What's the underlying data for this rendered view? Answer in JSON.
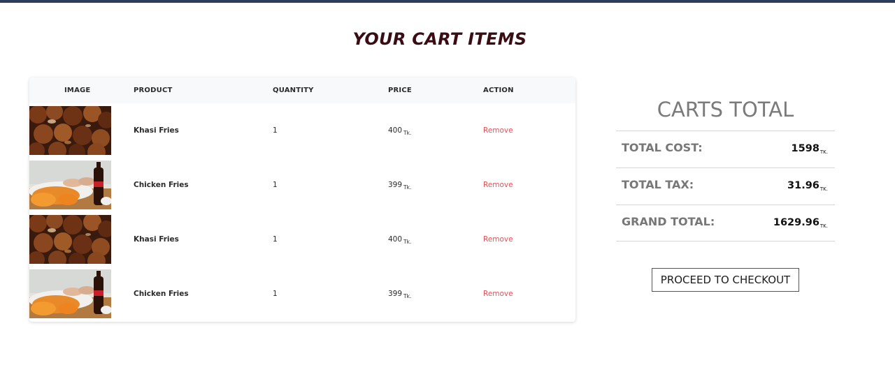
{
  "page": {
    "title": "YOUR CART ITEMS",
    "accent_bar_color": "#2c3e5c"
  },
  "cart": {
    "headers": {
      "image": "IMAGE",
      "product": "PRODUCT",
      "quantity": "QUANTITY",
      "price": "PRICE",
      "action": "ACTION"
    },
    "currency": "Tk.",
    "rows": [
      {
        "image": "khasi-fries-photo",
        "product": "Khasi Fries",
        "quantity": "1",
        "price": "400",
        "action": "Remove"
      },
      {
        "image": "chicken-fries-photo",
        "product": "Chicken Fries",
        "quantity": "1",
        "price": "399",
        "action": "Remove"
      },
      {
        "image": "khasi-fries-photo",
        "product": "Khasi Fries",
        "quantity": "1",
        "price": "400",
        "action": "Remove"
      },
      {
        "image": "chicken-fries-photo",
        "product": "Chicken Fries",
        "quantity": "1",
        "price": "399",
        "action": "Remove"
      }
    ]
  },
  "totals": {
    "title": "CARTS TOTAL",
    "unit": "TK.",
    "cost_label": "TOTAL COST:",
    "cost_value": "1598",
    "tax_label": "TOTAL TAX:",
    "tax_value": "31.96",
    "grand_label": "GRAND TOTAL:",
    "grand_value": "1629.96",
    "checkout_label": "PROCEED TO CHECKOUT"
  },
  "colors": {
    "remove_link": "#e2525a",
    "title": "#3a0d14"
  }
}
